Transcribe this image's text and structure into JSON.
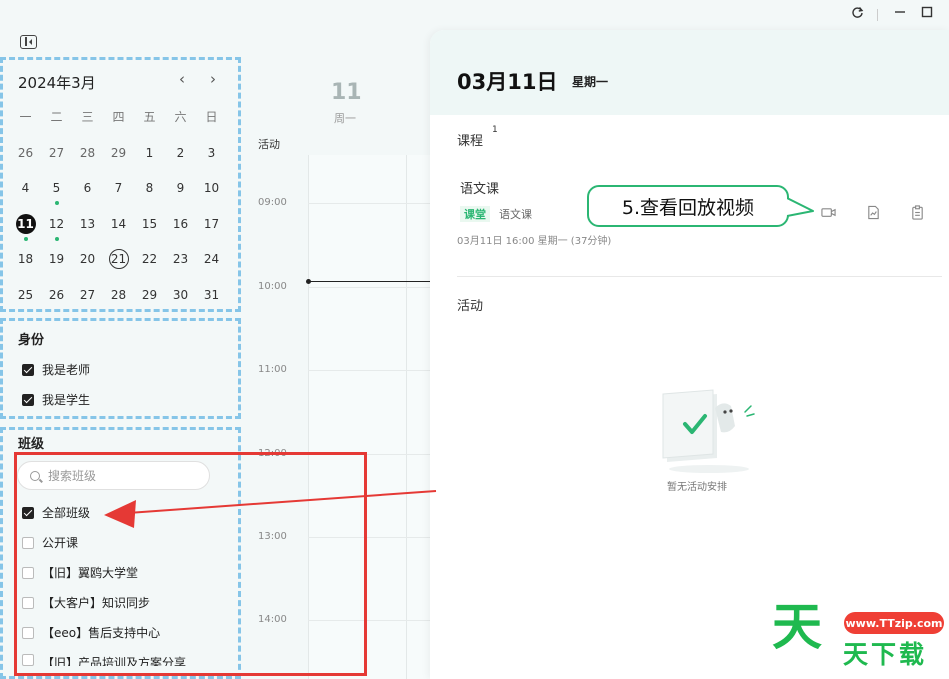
{
  "window": {
    "refresh_icon": "refresh-icon",
    "minimize_icon": "minimize-icon",
    "maximize_icon": "maximize-icon"
  },
  "calendar": {
    "month_title": "2024年3月",
    "prev": "‹",
    "next": "›",
    "weekdays": [
      "一",
      "二",
      "三",
      "四",
      "五",
      "六",
      "日"
    ],
    "weeks": [
      [
        "26",
        "27",
        "28",
        "29",
        "1",
        "2",
        "3"
      ],
      [
        "4",
        "5",
        "6",
        "7",
        "8",
        "9",
        "10"
      ],
      [
        "11",
        "12",
        "13",
        "14",
        "15",
        "16",
        "17"
      ],
      [
        "18",
        "19",
        "20",
        "21",
        "22",
        "23",
        "24"
      ],
      [
        "25",
        "26",
        "27",
        "28",
        "29",
        "30",
        "31"
      ]
    ]
  },
  "identity": {
    "title": "身份",
    "options": [
      {
        "label": "我是老师",
        "checked": true
      },
      {
        "label": "我是学生",
        "checked": true
      }
    ]
  },
  "classes": {
    "title": "班级",
    "search_placeholder": "搜索班级",
    "options": [
      {
        "label": "全部班级",
        "checked": true
      },
      {
        "label": "公开课",
        "checked": false
      },
      {
        "label": "【旧】翼鸥大学堂",
        "checked": false
      },
      {
        "label": "【大客户】知识同步",
        "checked": false
      },
      {
        "label": "【eeo】售后支持中心",
        "checked": false
      },
      {
        "label": "【旧】产品培训及方案分享",
        "checked": false
      }
    ]
  },
  "timeline": {
    "day_number": "11",
    "day_week": "周一",
    "activity_label": "活动",
    "times": [
      "09:00",
      "10:00",
      "11:00",
      "12:00",
      "13:00",
      "14:00"
    ]
  },
  "detail": {
    "date": "03月11日",
    "weekday": "星期一",
    "course_section": "课程",
    "course_count": "1",
    "course_name": "语文课",
    "tag": "课堂",
    "tag_text": "语文课",
    "course_time": "03月11日 16:00 星期一 (37分钟)",
    "activity_section": "活动",
    "empty_text": "暂无活动安排",
    "icons": [
      "video-icon",
      "chart-file-icon",
      "clipboard-icon"
    ]
  },
  "callout": {
    "text": "5.查看回放视频"
  },
  "watermark": {
    "big_char": "天",
    "pill": "www.TTzip.com",
    "small": "天下载"
  },
  "colors": {
    "accent_green": "#2bb673",
    "annotation_red": "#e53935",
    "dashed_blue": "#86c5e8"
  }
}
